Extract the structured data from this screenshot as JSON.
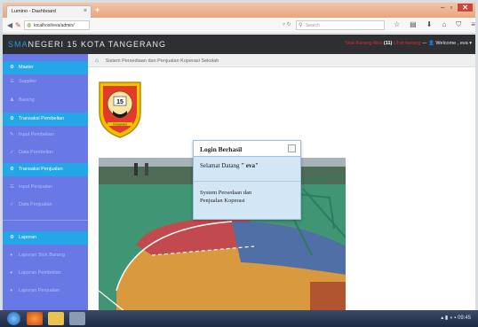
{
  "browser": {
    "tab_title": "Lumino - Dashboard",
    "new_tab": "+",
    "url": "localhost/eva/admin/",
    "search_placeholder": "Search",
    "window_controls": [
      "–",
      "▫",
      "✕"
    ]
  },
  "app": {
    "brand_prefix": "SMA",
    "brand_rest": "NEGERI 15 KOTA TANGERANG",
    "stock_alert_prefix": "Stok Barang Abis",
    "stock_alert_count": "(11)",
    "stock_alert_suffix": "Lihat barang",
    "welcome": "Welcome , eva"
  },
  "sidebar": {
    "items": [
      {
        "label": "Master",
        "kind": "head",
        "icon": "gear-icon"
      },
      {
        "label": "Supplier",
        "kind": "sub",
        "icon": "list-icon"
      },
      {
        "label": "Barang",
        "kind": "sub",
        "icon": "user-icon"
      },
      {
        "label": "Transaksi Pembelian",
        "kind": "head",
        "icon": "gear-icon"
      },
      {
        "label": "Input Pembelian",
        "kind": "sub",
        "icon": "pencil-icon"
      },
      {
        "label": "Data Pembelian",
        "kind": "sub",
        "icon": "check-icon"
      },
      {
        "label": "Transaksi Penjualan",
        "kind": "head",
        "icon": "gear-icon"
      },
      {
        "label": "Input Penjualan",
        "kind": "sub",
        "icon": "list-icon"
      },
      {
        "label": "Data Penjualan",
        "kind": "sub",
        "icon": "check-icon"
      },
      {
        "label": "Laporan",
        "kind": "head",
        "icon": "gear-icon"
      },
      {
        "label": "Laporan Stok Barang",
        "kind": "sub",
        "icon": "dot-icon"
      },
      {
        "label": "Laporan Pembelian",
        "kind": "sub",
        "icon": "dot-icon"
      },
      {
        "label": "Laporan Penjualan",
        "kind": "sub",
        "icon": "dot-icon"
      }
    ]
  },
  "breadcrumb": {
    "text": "Sistem Persediaan dan Penjualan Koperasi Sekolah"
  },
  "logo": {
    "text_top": "SEKOLAH MENENGAH ATAS",
    "number": "15",
    "text_bottom": "TANGERANG"
  },
  "modal": {
    "title": "Login Berhasil",
    "message_prefix": "Selamat Datang",
    "user": "\" eva\"",
    "body_line1": "System Persedaan dan",
    "body_line2": "Penjualan Koperasi"
  },
  "taskbar": {
    "time": "09:45"
  },
  "colors": {
    "sidebar_bg": "#6879e6",
    "sidebar_head": "#23a7e8",
    "header_bg": "#2d2f33",
    "brand_accent": "#1e9be6",
    "alert_red": "#e02a2a"
  }
}
